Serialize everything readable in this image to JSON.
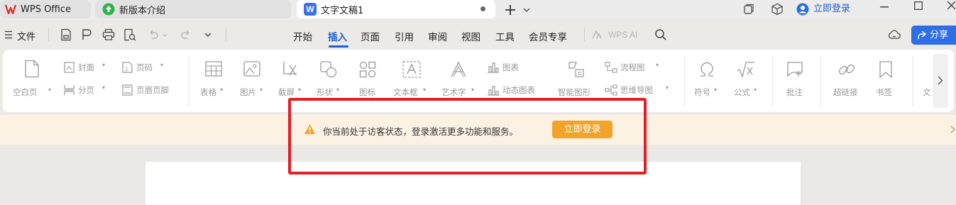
{
  "titlebar": {
    "tabs": [
      {
        "label": "WPS Office"
      },
      {
        "label": "新版本介绍"
      },
      {
        "label": "文字文稿1"
      }
    ],
    "doc_icon_letter": "W",
    "login_label": "立即登录"
  },
  "menubar": {
    "file_label": "文件",
    "tabs": [
      "开始",
      "插入",
      "页面",
      "引用",
      "审阅",
      "视图",
      "工具",
      "会员专享"
    ],
    "active_tab": "插入",
    "wps_ai_label": "WPS AI",
    "share_label": "分享"
  },
  "ribbon": {
    "blank_page": "空白页",
    "cover": "封面",
    "page_break": "分页",
    "page_number": "页码",
    "header_footer": "页眉页脚",
    "table": "表格",
    "picture": "图片",
    "screenshot": "截屏",
    "shape": "形状",
    "icon": "图标",
    "textbox": "文本框",
    "wordart": "艺术字",
    "chart": "图表",
    "dynamic_chart": "动态图表",
    "smart_graphic": "智能图形",
    "flowchart": "流程图",
    "mindmap": "思维导图",
    "symbol": "符号",
    "formula": "公式",
    "comment": "批注",
    "hyperlink": "超链接",
    "bookmark": "书签",
    "more": "文"
  },
  "notice": {
    "text": "你当前处于访客状态，登录激活更多功能和服务。",
    "button": "立即登录"
  },
  "colors": {
    "accent": "#1f5fd6",
    "warning": "#f2a42a",
    "highlight_box": "#e31e24"
  }
}
